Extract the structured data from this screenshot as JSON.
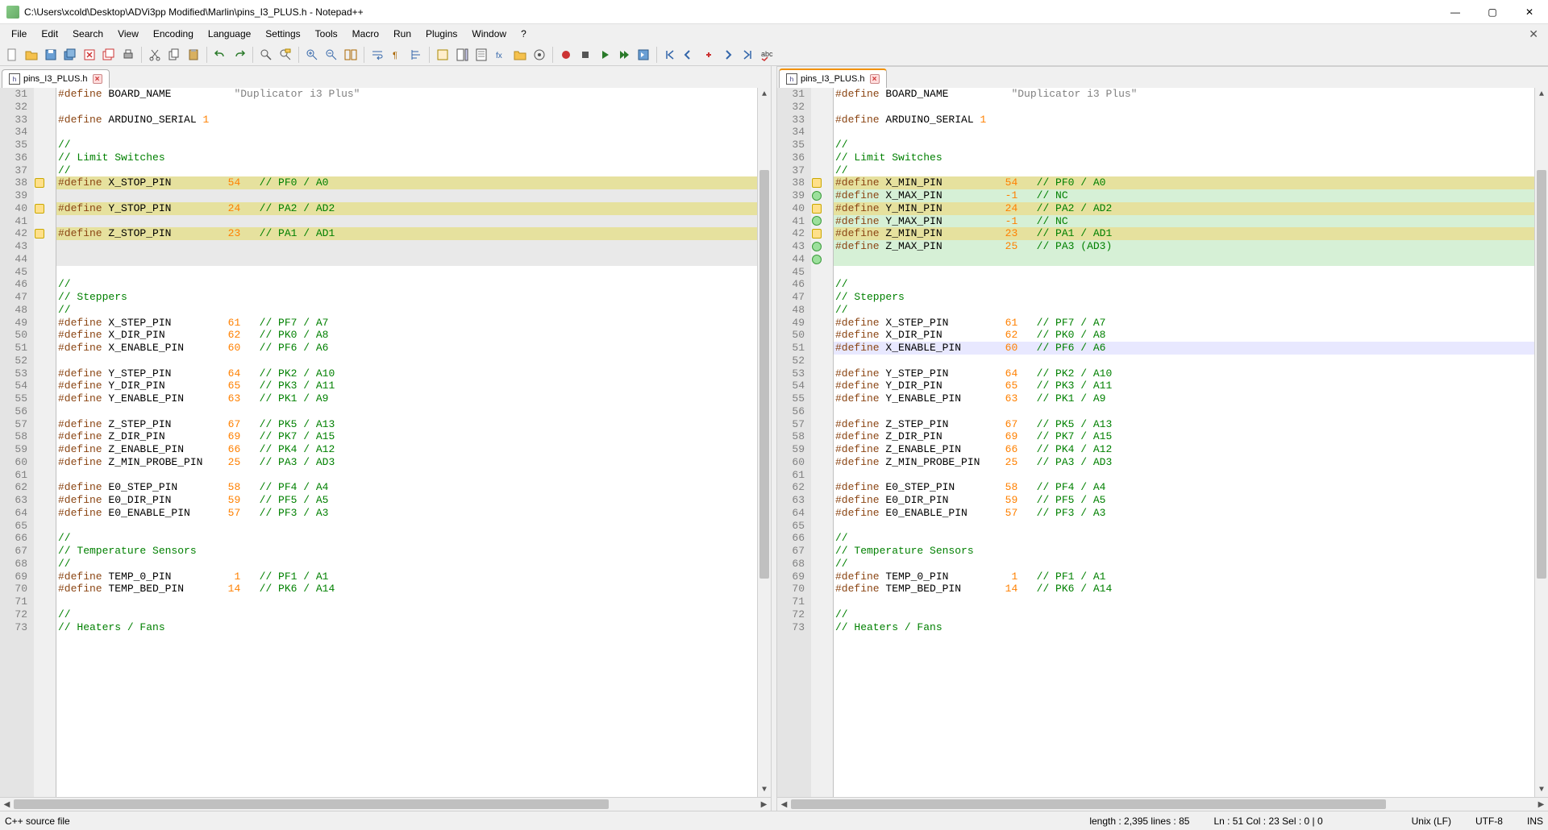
{
  "title": "C:\\Users\\xcold\\Desktop\\ADVi3pp Modified\\Marlin\\pins_I3_PLUS.h - Notepad++",
  "menu": [
    "File",
    "Edit",
    "Search",
    "View",
    "Encoding",
    "Language",
    "Settings",
    "Tools",
    "Macro",
    "Run",
    "Plugins",
    "Window",
    "?"
  ],
  "tab": {
    "name": "pins_I3_PLUS.h"
  },
  "left_lines": [
    {
      "n": 31,
      "mk": "",
      "cls": "",
      "t1": "#define",
      "t2": " BOARD_NAME",
      "t3": "",
      "cmt": "",
      "str": "          \"Duplicator i3 Plus\""
    },
    {
      "n": 32,
      "mk": "",
      "cls": "",
      "t1": "",
      "t2": "",
      "t3": "",
      "cmt": "",
      "str": ""
    },
    {
      "n": 33,
      "mk": "",
      "cls": "",
      "t1": "#define",
      "t2": " ARDUINO_SERIAL ",
      "t3": "1",
      "cmt": "",
      "str": ""
    },
    {
      "n": 34,
      "mk": "",
      "cls": "",
      "t1": "",
      "t2": "",
      "t3": "",
      "cmt": "",
      "str": ""
    },
    {
      "n": 35,
      "mk": "",
      "cls": "",
      "t1": "",
      "t2": "",
      "t3": "",
      "cmt": "//",
      "str": ""
    },
    {
      "n": 36,
      "mk": "",
      "cls": "",
      "t1": "",
      "t2": "",
      "t3": "",
      "cmt": "// Limit Switches",
      "str": ""
    },
    {
      "n": 37,
      "mk": "",
      "cls": "",
      "t1": "",
      "t2": "",
      "t3": "",
      "cmt": "//",
      "str": ""
    },
    {
      "n": 38,
      "mk": "changed",
      "cls": "hl-yellow",
      "t1": "#define",
      "t2": " X_STOP_PIN         ",
      "t3": "54",
      "cmt": "   // PF0 / A0",
      "str": ""
    },
    {
      "n": 39,
      "mk": "",
      "cls": "hl-gap",
      "t1": "",
      "t2": "",
      "t3": "",
      "cmt": "",
      "str": ""
    },
    {
      "n": 40,
      "mk": "changed",
      "cls": "hl-yellow",
      "t1": "#define",
      "t2": " Y_STOP_PIN         ",
      "t3": "24",
      "cmt": "   // PA2 / AD2",
      "str": ""
    },
    {
      "n": 41,
      "mk": "",
      "cls": "hl-gap",
      "t1": "",
      "t2": "",
      "t3": "",
      "cmt": "",
      "str": ""
    },
    {
      "n": 42,
      "mk": "changed",
      "cls": "hl-yellow",
      "t1": "#define",
      "t2": " Z_STOP_PIN         ",
      "t3": "23",
      "cmt": "   // PA1 / AD1",
      "str": ""
    },
    {
      "n": 43,
      "mk": "",
      "cls": "hl-gap",
      "t1": "",
      "t2": "",
      "t3": "",
      "cmt": "",
      "str": ""
    },
    {
      "n": 44,
      "mk": "",
      "cls": "hl-gap",
      "t1": "",
      "t2": "",
      "t3": "",
      "cmt": "",
      "str": ""
    },
    {
      "n": 45,
      "mk": "",
      "cls": "",
      "t1": "",
      "t2": "",
      "t3": "",
      "cmt": "",
      "str": ""
    },
    {
      "n": 46,
      "mk": "",
      "cls": "",
      "t1": "",
      "t2": "",
      "t3": "",
      "cmt": "//",
      "str": ""
    },
    {
      "n": 47,
      "mk": "",
      "cls": "",
      "t1": "",
      "t2": "",
      "t3": "",
      "cmt": "// Steppers",
      "str": ""
    },
    {
      "n": 48,
      "mk": "",
      "cls": "",
      "t1": "",
      "t2": "",
      "t3": "",
      "cmt": "//",
      "str": ""
    },
    {
      "n": 49,
      "mk": "",
      "cls": "",
      "t1": "#define",
      "t2": " X_STEP_PIN         ",
      "t3": "61",
      "cmt": "   // PF7 / A7",
      "str": ""
    },
    {
      "n": 50,
      "mk": "",
      "cls": "",
      "t1": "#define",
      "t2": " X_DIR_PIN          ",
      "t3": "62",
      "cmt": "   // PK0 / A8",
      "str": ""
    },
    {
      "n": 51,
      "mk": "",
      "cls": "",
      "t1": "#define",
      "t2": " X_ENABLE_PIN       ",
      "t3": "60",
      "cmt": "   // PF6 / A6",
      "str": ""
    },
    {
      "n": 52,
      "mk": "",
      "cls": "",
      "t1": "",
      "t2": "",
      "t3": "",
      "cmt": "",
      "str": ""
    },
    {
      "n": 53,
      "mk": "",
      "cls": "",
      "t1": "#define",
      "t2": " Y_STEP_PIN         ",
      "t3": "64",
      "cmt": "   // PK2 / A10",
      "str": ""
    },
    {
      "n": 54,
      "mk": "",
      "cls": "",
      "t1": "#define",
      "t2": " Y_DIR_PIN          ",
      "t3": "65",
      "cmt": "   // PK3 / A11",
      "str": ""
    },
    {
      "n": 55,
      "mk": "",
      "cls": "",
      "t1": "#define",
      "t2": " Y_ENABLE_PIN       ",
      "t3": "63",
      "cmt": "   // PK1 / A9",
      "str": ""
    },
    {
      "n": 56,
      "mk": "",
      "cls": "",
      "t1": "",
      "t2": "",
      "t3": "",
      "cmt": "",
      "str": ""
    },
    {
      "n": 57,
      "mk": "",
      "cls": "",
      "t1": "#define",
      "t2": " Z_STEP_PIN         ",
      "t3": "67",
      "cmt": "   // PK5 / A13",
      "str": ""
    },
    {
      "n": 58,
      "mk": "",
      "cls": "",
      "t1": "#define",
      "t2": " Z_DIR_PIN          ",
      "t3": "69",
      "cmt": "   // PK7 / A15",
      "str": ""
    },
    {
      "n": 59,
      "mk": "",
      "cls": "",
      "t1": "#define",
      "t2": " Z_ENABLE_PIN       ",
      "t3": "66",
      "cmt": "   // PK4 / A12",
      "str": ""
    },
    {
      "n": 60,
      "mk": "",
      "cls": "",
      "t1": "#define",
      "t2": " Z_MIN_PROBE_PIN    ",
      "t3": "25",
      "cmt": "   // PA3 / AD3",
      "str": ""
    },
    {
      "n": 61,
      "mk": "",
      "cls": "",
      "t1": "",
      "t2": "",
      "t3": "",
      "cmt": "",
      "str": ""
    },
    {
      "n": 62,
      "mk": "",
      "cls": "",
      "t1": "#define",
      "t2": " E0_STEP_PIN        ",
      "t3": "58",
      "cmt": "   // PF4 / A4",
      "str": ""
    },
    {
      "n": 63,
      "mk": "",
      "cls": "",
      "t1": "#define",
      "t2": " E0_DIR_PIN         ",
      "t3": "59",
      "cmt": "   // PF5 / A5",
      "str": ""
    },
    {
      "n": 64,
      "mk": "",
      "cls": "",
      "t1": "#define",
      "t2": " E0_ENABLE_PIN      ",
      "t3": "57",
      "cmt": "   // PF3 / A3",
      "str": ""
    },
    {
      "n": 65,
      "mk": "",
      "cls": "",
      "t1": "",
      "t2": "",
      "t3": "",
      "cmt": "",
      "str": ""
    },
    {
      "n": 66,
      "mk": "",
      "cls": "",
      "t1": "",
      "t2": "",
      "t3": "",
      "cmt": "//",
      "str": ""
    },
    {
      "n": 67,
      "mk": "",
      "cls": "",
      "t1": "",
      "t2": "",
      "t3": "",
      "cmt": "// Temperature Sensors",
      "str": ""
    },
    {
      "n": 68,
      "mk": "",
      "cls": "",
      "t1": "",
      "t2": "",
      "t3": "",
      "cmt": "//",
      "str": ""
    },
    {
      "n": 69,
      "mk": "",
      "cls": "",
      "t1": "#define",
      "t2": " TEMP_0_PIN          ",
      "t3": "1",
      "cmt": "   // PF1 / A1",
      "str": ""
    },
    {
      "n": 70,
      "mk": "",
      "cls": "",
      "t1": "#define",
      "t2": " TEMP_BED_PIN       ",
      "t3": "14",
      "cmt": "   // PK6 / A14",
      "str": ""
    },
    {
      "n": 71,
      "mk": "",
      "cls": "",
      "t1": "",
      "t2": "",
      "t3": "",
      "cmt": "",
      "str": ""
    },
    {
      "n": 72,
      "mk": "",
      "cls": "",
      "t1": "",
      "t2": "",
      "t3": "",
      "cmt": "//",
      "str": ""
    },
    {
      "n": 73,
      "mk": "",
      "cls": "",
      "t1": "",
      "t2": "",
      "t3": "",
      "cmt": "// Heaters / Fans",
      "str": ""
    }
  ],
  "right_lines": [
    {
      "n": 31,
      "mk": "",
      "cls": "",
      "t1": "#define",
      "t2": " BOARD_NAME",
      "t3": "",
      "cmt": "",
      "str": "          \"Duplicator i3 Plus\""
    },
    {
      "n": 32,
      "mk": "",
      "cls": "",
      "t1": "",
      "t2": "",
      "t3": "",
      "cmt": "",
      "str": ""
    },
    {
      "n": 33,
      "mk": "",
      "cls": "",
      "t1": "#define",
      "t2": " ARDUINO_SERIAL ",
      "t3": "1",
      "cmt": "",
      "str": ""
    },
    {
      "n": 34,
      "mk": "",
      "cls": "",
      "t1": "",
      "t2": "",
      "t3": "",
      "cmt": "",
      "str": ""
    },
    {
      "n": 35,
      "mk": "",
      "cls": "",
      "t1": "",
      "t2": "",
      "t3": "",
      "cmt": "//",
      "str": ""
    },
    {
      "n": 36,
      "mk": "",
      "cls": "",
      "t1": "",
      "t2": "",
      "t3": "",
      "cmt": "// Limit Switches",
      "str": ""
    },
    {
      "n": 37,
      "mk": "",
      "cls": "",
      "t1": "",
      "t2": "",
      "t3": "",
      "cmt": "//",
      "str": ""
    },
    {
      "n": 38,
      "mk": "changed",
      "cls": "hl-yellow",
      "t1": "#define",
      "t2": " X_MIN_PIN          ",
      "t3": "54",
      "cmt": "   // PF0 / A0",
      "str": ""
    },
    {
      "n": 39,
      "mk": "added",
      "cls": "hl-green",
      "t1": "#define",
      "t2": " X_MAX_PIN          ",
      "t3": "-1",
      "cmt": "   // NC",
      "str": ""
    },
    {
      "n": 40,
      "mk": "changed",
      "cls": "hl-yellow",
      "t1": "#define",
      "t2": " Y_MIN_PIN          ",
      "t3": "24",
      "cmt": "   // PA2 / AD2",
      "str": ""
    },
    {
      "n": 41,
      "mk": "added",
      "cls": "hl-green",
      "t1": "#define",
      "t2": " Y_MAX_PIN          ",
      "t3": "-1",
      "cmt": "   // NC",
      "str": ""
    },
    {
      "n": 42,
      "mk": "changed",
      "cls": "hl-yellow",
      "t1": "#define",
      "t2": " Z_MIN_PIN          ",
      "t3": "23",
      "cmt": "   // PA1 / AD1",
      "str": ""
    },
    {
      "n": 43,
      "mk": "added",
      "cls": "hl-green",
      "t1": "#define",
      "t2": " Z_MAX_PIN          ",
      "t3": "25",
      "cmt": "   // PA3 (AD3)",
      "str": ""
    },
    {
      "n": 44,
      "mk": "added",
      "cls": "hl-green",
      "t1": "",
      "t2": "",
      "t3": "",
      "cmt": "",
      "str": ""
    },
    {
      "n": 45,
      "mk": "",
      "cls": "",
      "t1": "",
      "t2": "",
      "t3": "",
      "cmt": "",
      "str": ""
    },
    {
      "n": 46,
      "mk": "",
      "cls": "",
      "t1": "",
      "t2": "",
      "t3": "",
      "cmt": "//",
      "str": ""
    },
    {
      "n": 47,
      "mk": "",
      "cls": "",
      "t1": "",
      "t2": "",
      "t3": "",
      "cmt": "// Steppers",
      "str": ""
    },
    {
      "n": 48,
      "mk": "",
      "cls": "",
      "t1": "",
      "t2": "",
      "t3": "",
      "cmt": "//",
      "str": ""
    },
    {
      "n": 49,
      "mk": "",
      "cls": "",
      "t1": "#define",
      "t2": " X_STEP_PIN         ",
      "t3": "61",
      "cmt": "   // PF7 / A7",
      "str": ""
    },
    {
      "n": 50,
      "mk": "",
      "cls": "",
      "t1": "#define",
      "t2": " X_DIR_PIN          ",
      "t3": "62",
      "cmt": "   // PK0 / A8",
      "str": ""
    },
    {
      "n": 51,
      "mk": "",
      "cls": "hl-cursor",
      "t1": "#define",
      "t2": " X_ENABLE_PIN       ",
      "t3": "60",
      "cmt": "   // PF6 / A6",
      "str": ""
    },
    {
      "n": 52,
      "mk": "",
      "cls": "",
      "t1": "",
      "t2": "",
      "t3": "",
      "cmt": "",
      "str": ""
    },
    {
      "n": 53,
      "mk": "",
      "cls": "",
      "t1": "#define",
      "t2": " Y_STEP_PIN         ",
      "t3": "64",
      "cmt": "   // PK2 / A10",
      "str": ""
    },
    {
      "n": 54,
      "mk": "",
      "cls": "",
      "t1": "#define",
      "t2": " Y_DIR_PIN          ",
      "t3": "65",
      "cmt": "   // PK3 / A11",
      "str": ""
    },
    {
      "n": 55,
      "mk": "",
      "cls": "",
      "t1": "#define",
      "t2": " Y_ENABLE_PIN       ",
      "t3": "63",
      "cmt": "   // PK1 / A9",
      "str": ""
    },
    {
      "n": 56,
      "mk": "",
      "cls": "",
      "t1": "",
      "t2": "",
      "t3": "",
      "cmt": "",
      "str": ""
    },
    {
      "n": 57,
      "mk": "",
      "cls": "",
      "t1": "#define",
      "t2": " Z_STEP_PIN         ",
      "t3": "67",
      "cmt": "   // PK5 / A13",
      "str": ""
    },
    {
      "n": 58,
      "mk": "",
      "cls": "",
      "t1": "#define",
      "t2": " Z_DIR_PIN          ",
      "t3": "69",
      "cmt": "   // PK7 / A15",
      "str": ""
    },
    {
      "n": 59,
      "mk": "",
      "cls": "",
      "t1": "#define",
      "t2": " Z_ENABLE_PIN       ",
      "t3": "66",
      "cmt": "   // PK4 / A12",
      "str": ""
    },
    {
      "n": 60,
      "mk": "",
      "cls": "",
      "t1": "#define",
      "t2": " Z_MIN_PROBE_PIN    ",
      "t3": "25",
      "cmt": "   // PA3 / AD3",
      "str": ""
    },
    {
      "n": 61,
      "mk": "",
      "cls": "",
      "t1": "",
      "t2": "",
      "t3": "",
      "cmt": "",
      "str": ""
    },
    {
      "n": 62,
      "mk": "",
      "cls": "",
      "t1": "#define",
      "t2": " E0_STEP_PIN        ",
      "t3": "58",
      "cmt": "   // PF4 / A4",
      "str": ""
    },
    {
      "n": 63,
      "mk": "",
      "cls": "",
      "t1": "#define",
      "t2": " E0_DIR_PIN         ",
      "t3": "59",
      "cmt": "   // PF5 / A5",
      "str": ""
    },
    {
      "n": 64,
      "mk": "",
      "cls": "",
      "t1": "#define",
      "t2": " E0_ENABLE_PIN      ",
      "t3": "57",
      "cmt": "   // PF3 / A3",
      "str": ""
    },
    {
      "n": 65,
      "mk": "",
      "cls": "",
      "t1": "",
      "t2": "",
      "t3": "",
      "cmt": "",
      "str": ""
    },
    {
      "n": 66,
      "mk": "",
      "cls": "",
      "t1": "",
      "t2": "",
      "t3": "",
      "cmt": "//",
      "str": ""
    },
    {
      "n": 67,
      "mk": "",
      "cls": "",
      "t1": "",
      "t2": "",
      "t3": "",
      "cmt": "// Temperature Sensors",
      "str": ""
    },
    {
      "n": 68,
      "mk": "",
      "cls": "",
      "t1": "",
      "t2": "",
      "t3": "",
      "cmt": "//",
      "str": ""
    },
    {
      "n": 69,
      "mk": "",
      "cls": "",
      "t1": "#define",
      "t2": " TEMP_0_PIN          ",
      "t3": "1",
      "cmt": "   // PF1 / A1",
      "str": ""
    },
    {
      "n": 70,
      "mk": "",
      "cls": "",
      "t1": "#define",
      "t2": " TEMP_BED_PIN       ",
      "t3": "14",
      "cmt": "   // PK6 / A14",
      "str": ""
    },
    {
      "n": 71,
      "mk": "",
      "cls": "",
      "t1": "",
      "t2": "",
      "t3": "",
      "cmt": "",
      "str": ""
    },
    {
      "n": 72,
      "mk": "",
      "cls": "",
      "t1": "",
      "t2": "",
      "t3": "",
      "cmt": "//",
      "str": ""
    },
    {
      "n": 73,
      "mk": "",
      "cls": "",
      "t1": "",
      "t2": "",
      "t3": "",
      "cmt": "// Heaters / Fans",
      "str": ""
    }
  ],
  "status": {
    "lang": "C++ source file",
    "length": "length : 2,395    lines : 85",
    "pos": "Ln : 51    Col : 23    Sel : 0 | 0",
    "eol": "Unix (LF)",
    "enc": "UTF-8",
    "ins": "INS"
  }
}
